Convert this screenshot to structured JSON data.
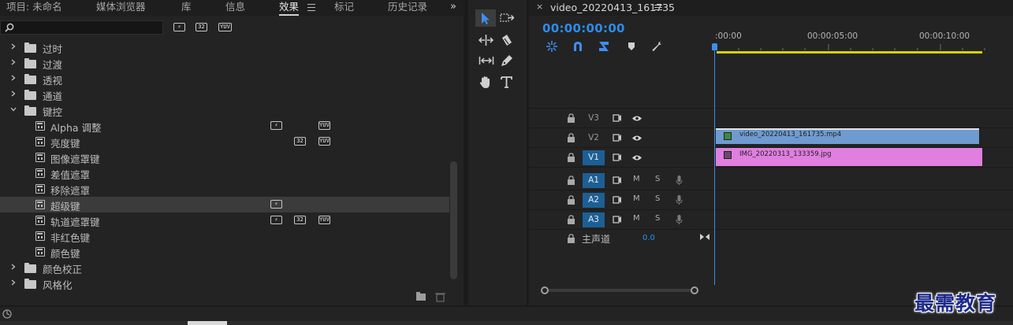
{
  "tabs": [
    {
      "label": "项目: 未命名",
      "active": false
    },
    {
      "label": "媒体浏览器",
      "active": false
    },
    {
      "label": "库",
      "active": false
    },
    {
      "label": "信息",
      "active": false
    },
    {
      "label": "效果",
      "active": true
    },
    {
      "label": "标记",
      "active": false
    },
    {
      "label": "历史记录",
      "active": false
    }
  ],
  "overflow_glyph": "»",
  "badges": {
    "accel": "⚡",
    "bit32": "32",
    "yuv": "YUV"
  },
  "effects_tree": [
    {
      "label": "过时",
      "type": "folder",
      "expanded": false
    },
    {
      "label": "过渡",
      "type": "folder",
      "expanded": false
    },
    {
      "label": "透视",
      "type": "folder",
      "expanded": false
    },
    {
      "label": "通道",
      "type": "folder",
      "expanded": false
    },
    {
      "label": "键控",
      "type": "folder",
      "expanded": true
    },
    {
      "label": "Alpha 调整",
      "type": "preset",
      "accel": true,
      "bit32": false,
      "yuv": true
    },
    {
      "label": "亮度键",
      "type": "preset",
      "accel": false,
      "bit32": true,
      "yuv": true
    },
    {
      "label": "图像遮罩键",
      "type": "preset",
      "accel": false,
      "bit32": false,
      "yuv": false
    },
    {
      "label": "差值遮罩",
      "type": "preset",
      "accel": false,
      "bit32": false,
      "yuv": false
    },
    {
      "label": "移除遮罩",
      "type": "preset",
      "accel": false,
      "bit32": false,
      "yuv": false
    },
    {
      "label": "超级键",
      "type": "preset",
      "accel": true,
      "bit32": false,
      "yuv": false,
      "selected": true
    },
    {
      "label": "轨道遮罩键",
      "type": "preset",
      "accel": true,
      "bit32": true,
      "yuv": true
    },
    {
      "label": "非红色键",
      "type": "preset",
      "accel": false,
      "bit32": false,
      "yuv": false
    },
    {
      "label": "颜色键",
      "type": "preset",
      "accel": false,
      "bit32": false,
      "yuv": false
    },
    {
      "label": "颜色校正",
      "type": "folder",
      "expanded": false
    },
    {
      "label": "风格化",
      "type": "folder",
      "expanded": false
    }
  ],
  "tools": [
    "selection-tool",
    "track-select-tool",
    "ripple-edit-tool",
    "razor-tool",
    "slip-tool",
    "pen-tool",
    "hand-tool",
    "type-tool"
  ],
  "sequence": {
    "close_glyph": "×",
    "name": "video_20220413_161735",
    "timecode": "00:00:00:00",
    "ruler_labels": [
      ":00:00",
      "00:00:05:00",
      "00:00:10:00"
    ]
  },
  "tracks": [
    {
      "id": "V3",
      "kind": "video",
      "targeted": false
    },
    {
      "id": "V2",
      "kind": "video",
      "targeted": false
    },
    {
      "id": "V1",
      "kind": "video",
      "targeted": true
    },
    {
      "id": "A1",
      "kind": "audio",
      "targeted": true
    },
    {
      "id": "A2",
      "kind": "audio",
      "targeted": true
    },
    {
      "id": "A3",
      "kind": "audio",
      "targeted": true
    }
  ],
  "audio_buttons": {
    "mute": "M",
    "solo": "S"
  },
  "clips": {
    "v2": {
      "name": "video_20220413_161735.mp4",
      "color": "#6f9bd0"
    },
    "v1": {
      "name": "IMG_20220313_133359.jpg",
      "color": "#e07fe0"
    }
  },
  "master": {
    "label": "主声道",
    "value": "0.0"
  },
  "watermark": "最需教育"
}
